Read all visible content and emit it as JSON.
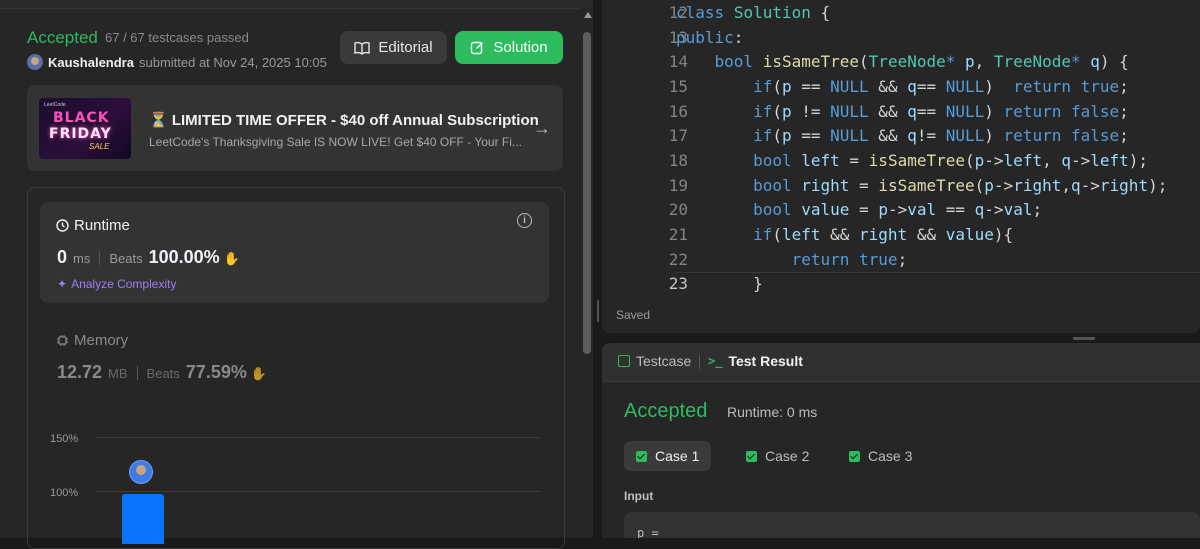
{
  "submission": {
    "status": "Accepted",
    "testcases": "67 / 67 testcases passed",
    "username": "Kaushalendra",
    "submitted_at": "submitted at Nov 24, 2025 10:05",
    "editorial_label": "Editorial",
    "solution_label": "Solution"
  },
  "promo": {
    "title": "⏳ LIMITED TIME OFFER - $40 off Annual Subscription",
    "subtitle": "LeetCode's Thanksgiving Sale IS NOW LIVE! Get $40 OFF - Your Fi...",
    "image_text_1": "BLACK",
    "image_text_2": "FRIDAY",
    "image_text_3": "SALE",
    "image_brand": "LeetCode"
  },
  "runtime": {
    "label": "Runtime",
    "value": "0",
    "unit": "ms",
    "beats_label": "Beats",
    "beats_value": "100.00%",
    "analyze_label": "Analyze Complexity"
  },
  "memory": {
    "label": "Memory",
    "value": "12.72",
    "unit": "MB",
    "beats_label": "Beats",
    "beats_value": "77.59%"
  },
  "distribution_chart": {
    "ticks": [
      "150%",
      "100%"
    ]
  },
  "editor": {
    "saved_label": "Saved",
    "line_numbers": [
      "12",
      "13",
      "14",
      "15",
      "16",
      "17",
      "18",
      "19",
      "20",
      "21",
      "22",
      "23"
    ],
    "active_line": "23"
  },
  "result": {
    "tab_testcase": "Testcase",
    "tab_result": "Test Result",
    "status": "Accepted",
    "runtime": "Runtime: 0 ms",
    "cases": [
      "Case 1",
      "Case 2",
      "Case 3"
    ],
    "input_label": "Input",
    "input_text": "p ="
  },
  "colors": {
    "accent_green": "#2cbb5d",
    "bar_blue": "#0b74ff",
    "analyze_purple": "#9b7ff5"
  }
}
